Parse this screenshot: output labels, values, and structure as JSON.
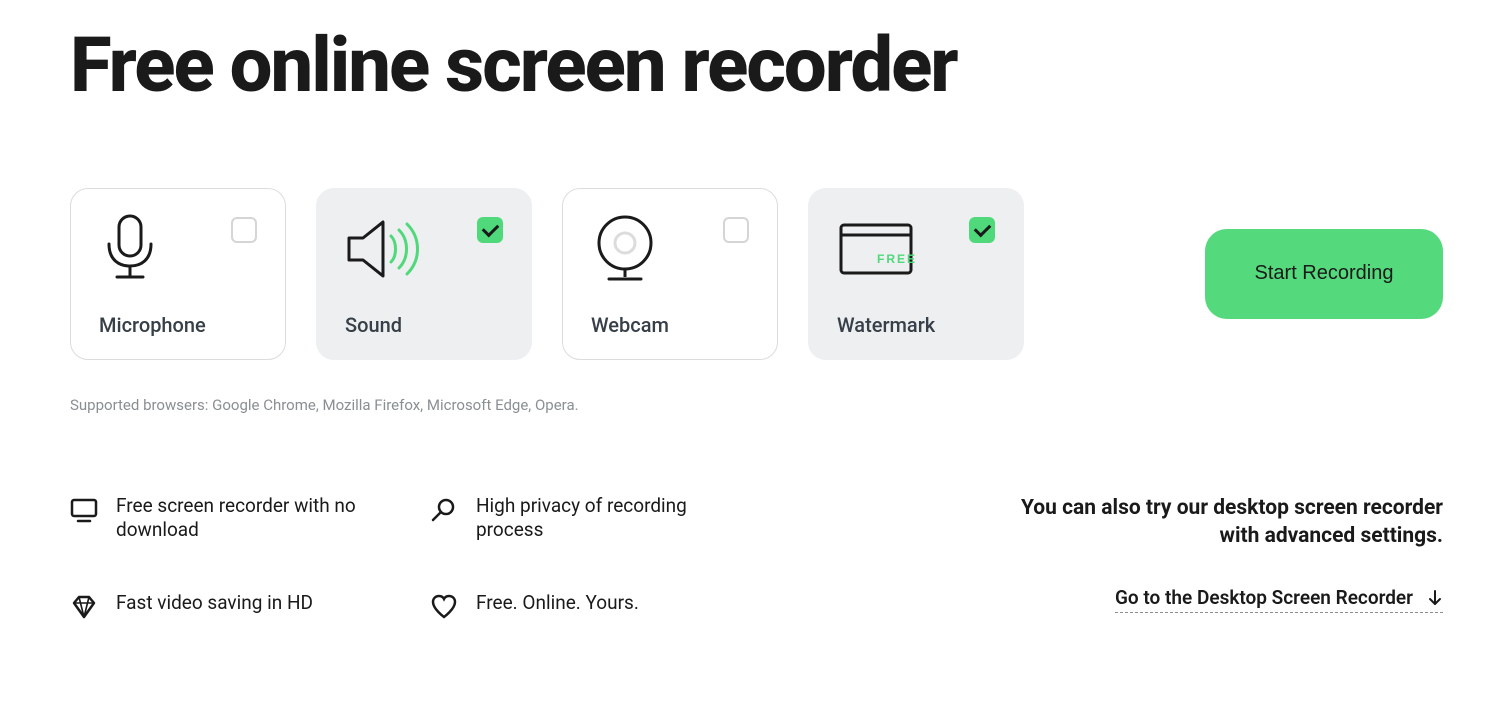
{
  "title": "Free online screen recorder",
  "options": [
    {
      "label": "Microphone",
      "checked": false
    },
    {
      "label": "Sound",
      "checked": true
    },
    {
      "label": "Webcam",
      "checked": false
    },
    {
      "label": "Watermark",
      "checked": true
    }
  ],
  "start_button": "Start Recording",
  "supported_text": "Supported browsers: Google Chrome, Mozilla Firefox, Microsoft Edge, Opera.",
  "features": [
    "Free screen recorder with no download",
    "High privacy of recording process",
    "Fast video saving in HD",
    "Free. Online. Yours."
  ],
  "promo_text": "You can also try our desktop screen recorder with advanced settings.",
  "promo_link": "Go to the Desktop Screen Recorder"
}
